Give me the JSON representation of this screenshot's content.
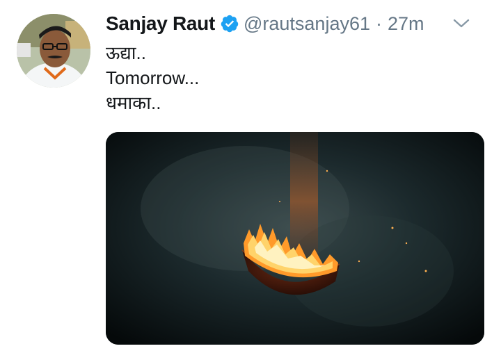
{
  "tweet": {
    "author": {
      "display_name": "Sanjay Raut",
      "handle": "@rautsanjay61",
      "verified": true,
      "avatar_icon": "profile-photo"
    },
    "separator": "·",
    "timestamp": "27m",
    "text_lines": [
      "ऊद्या..",
      "Tomorrow...",
      "धमाका.."
    ],
    "media": {
      "type": "image",
      "description_icon": "burning-disc"
    }
  },
  "colors": {
    "text": "#14171a",
    "secondary": "#657786",
    "verified_blue": "#1da1f2",
    "media_bg": "#0c1416"
  }
}
